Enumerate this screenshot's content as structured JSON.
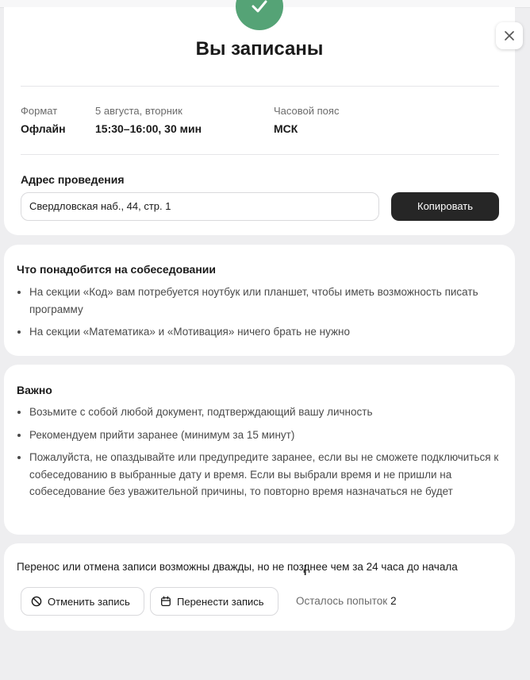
{
  "header": {
    "title": "Вы записаны"
  },
  "info": {
    "format_label": "Формат",
    "format_value": "Офлайн",
    "date_label": "5 августа, вторник",
    "time_value": "15:30–16:00, 30 мин",
    "timezone_label": "Часовой пояс",
    "timezone_value": "МСК"
  },
  "address": {
    "label": "Адрес проведения",
    "value": "Свердловская наб., 44, стр. 1",
    "copy_label": "Копировать"
  },
  "need": {
    "title": "Что понадобится на собеседовании",
    "items": [
      "На секции «Код» вам потребуется ноутбук или планшет, чтобы иметь возможность писать программу",
      "На секции «Математика» и «Мотивация» ничего брать не нужно"
    ]
  },
  "important": {
    "title": "Важно",
    "items": [
      "Возьмите с собой любой документ, подтверждающий вашу личность",
      "Рекомендуем прийти заранее (минимум за 15 минут)",
      "Пожалуйста, не опаздывайте или предупредите заранее, если вы не сможете подключиться к собеседованию в выбранные дату и время. Если вы выбрали время и не пришли на собеседование без уважительной причины, то повторно время назначаться не будет"
    ]
  },
  "reschedule": {
    "text": "Перенос или отмена записи возможны дважды, но не позднее чем за 24 часа до начала",
    "cancel_label": "Отменить запись",
    "move_label": "Перенести запись",
    "attempts_label": "Осталось попыток",
    "attempts_count": "2"
  },
  "icons": {
    "check": "check-icon",
    "close": "close-icon",
    "cancel": "cancel-circle-icon",
    "calendar": "calendar-icon",
    "cursor": "text-cursor-icon"
  },
  "colors": {
    "accent_green": "#55a376",
    "button_dark": "#262626",
    "page_bg": "#eeeef0"
  }
}
